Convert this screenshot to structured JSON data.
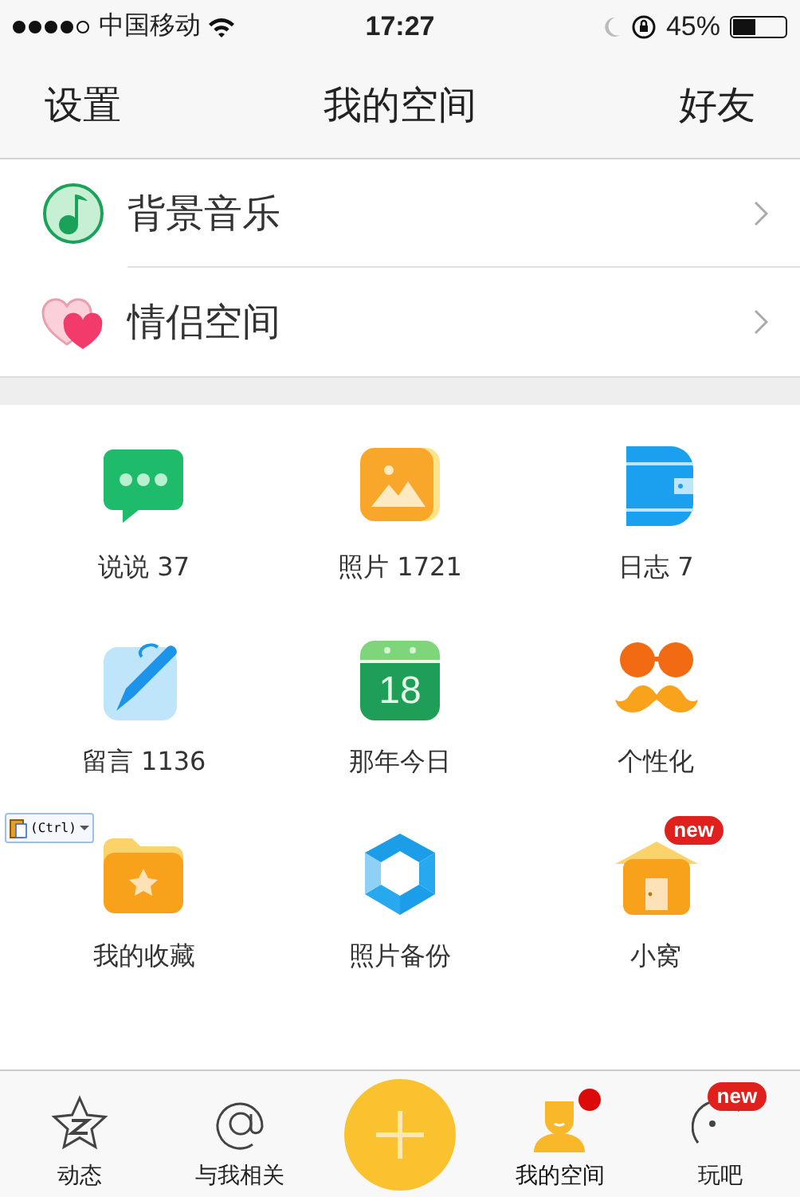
{
  "status_bar": {
    "carrier": "中国移动",
    "time": "17:27",
    "battery": "45%"
  },
  "nav": {
    "left": "设置",
    "title": "我的空间",
    "right": "好友"
  },
  "menu": [
    {
      "kind": "music",
      "label": "背景音乐"
    },
    {
      "kind": "couple",
      "label": "情侣空间"
    }
  ],
  "grid": [
    {
      "kind": "chat",
      "label": "说说 37"
    },
    {
      "kind": "photo",
      "label": "照片 1721"
    },
    {
      "kind": "diary",
      "label": "日志 7"
    },
    {
      "kind": "pen",
      "label": "留言 1136"
    },
    {
      "kind": "calendar",
      "label": "那年今日",
      "day": "18"
    },
    {
      "kind": "mustache",
      "label": "个性化"
    },
    {
      "kind": "folder",
      "label": "我的收藏"
    },
    {
      "kind": "shutter",
      "label": "照片备份"
    },
    {
      "kind": "house",
      "label": "小窝",
      "badge": "new"
    }
  ],
  "paste_popup": {
    "label": "(Ctrl)"
  },
  "tabs": [
    {
      "kind": "star",
      "label": "动态",
      "selected": false
    },
    {
      "kind": "at",
      "label": "与我相关",
      "selected": false
    },
    {
      "kind": "plus",
      "selected": false
    },
    {
      "kind": "person",
      "label": "我的空间",
      "selected": true,
      "dot": true
    },
    {
      "kind": "smile",
      "label": "玩吧",
      "selected": false,
      "badge": "new"
    }
  ]
}
